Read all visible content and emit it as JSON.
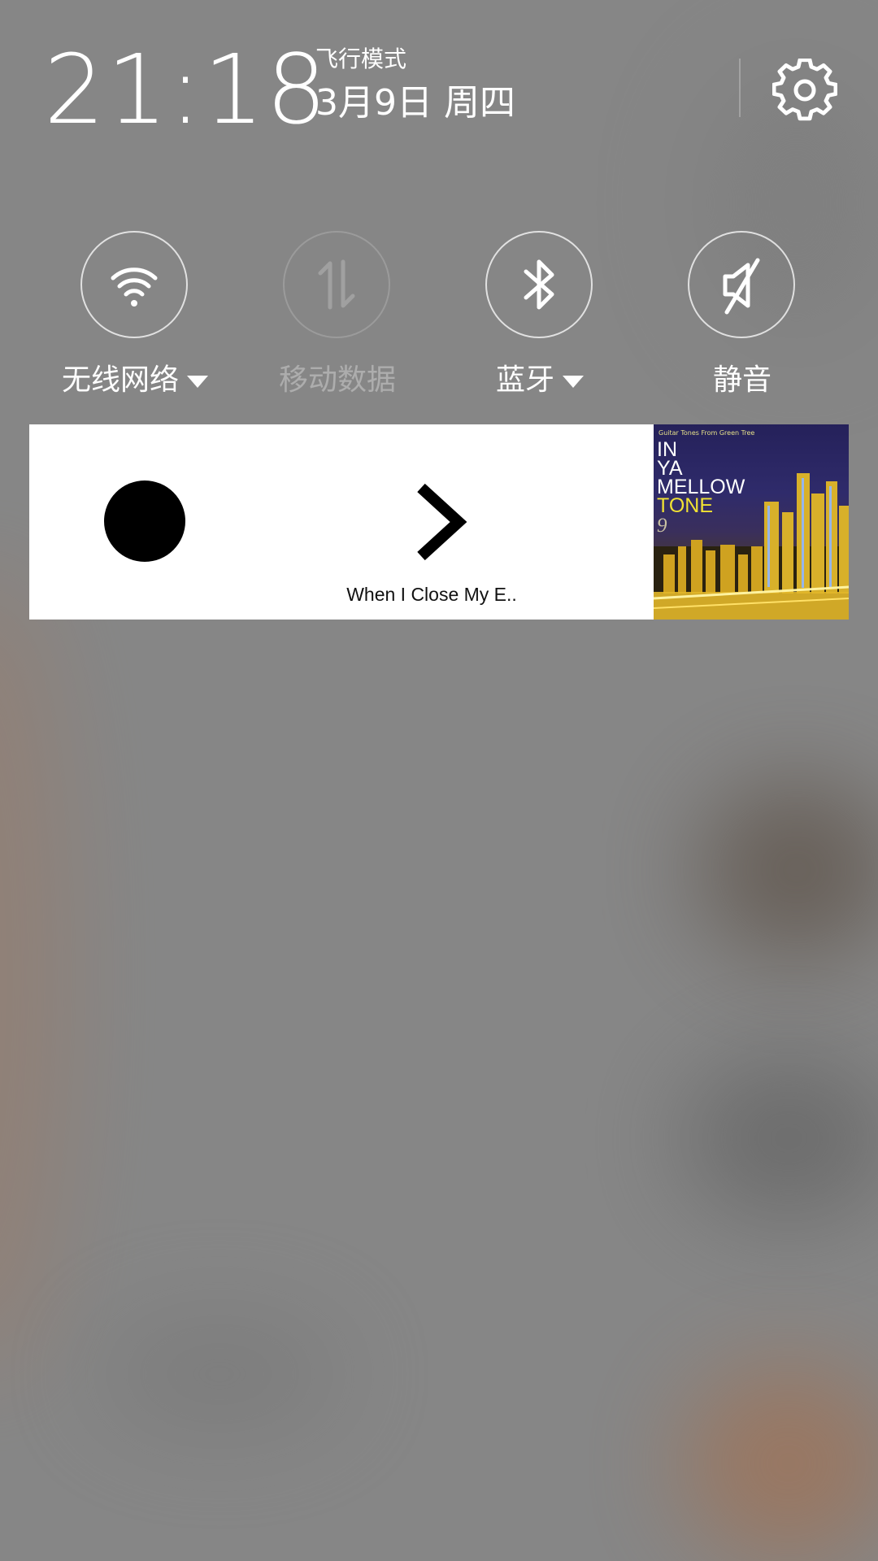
{
  "header": {
    "time": "21:18",
    "mode_label": "飞行模式",
    "date": "3月9日 周四"
  },
  "icons": {
    "settings": "gear-icon",
    "wifi": "wifi-icon",
    "mobile_data": "mobile-data-icon",
    "bluetooth": "bluetooth-icon",
    "mute": "mute-icon",
    "play": "play-icon",
    "next": "next-icon"
  },
  "quick_settings": {
    "wifi": {
      "label": "无线网络",
      "enabled": true,
      "has_dropdown": true
    },
    "mobile_data": {
      "label": "移动数据",
      "enabled": false,
      "has_dropdown": false
    },
    "bluetooth": {
      "label": "蓝牙",
      "enabled": true,
      "has_dropdown": true
    },
    "mute": {
      "label": "静音",
      "enabled": true,
      "has_dropdown": false
    }
  },
  "media_player": {
    "track_title": "When I Close My E..",
    "album_art": {
      "top_text": "Guitar Tones From  Green Tree",
      "line1": "IN",
      "line2": "YA",
      "line3": "MELLOW",
      "line4": "TONE",
      "line5": "9"
    }
  },
  "colors": {
    "background": "#868686",
    "text": "#ffffff",
    "card": "#ffffff",
    "album_accent": "#f1e233"
  }
}
